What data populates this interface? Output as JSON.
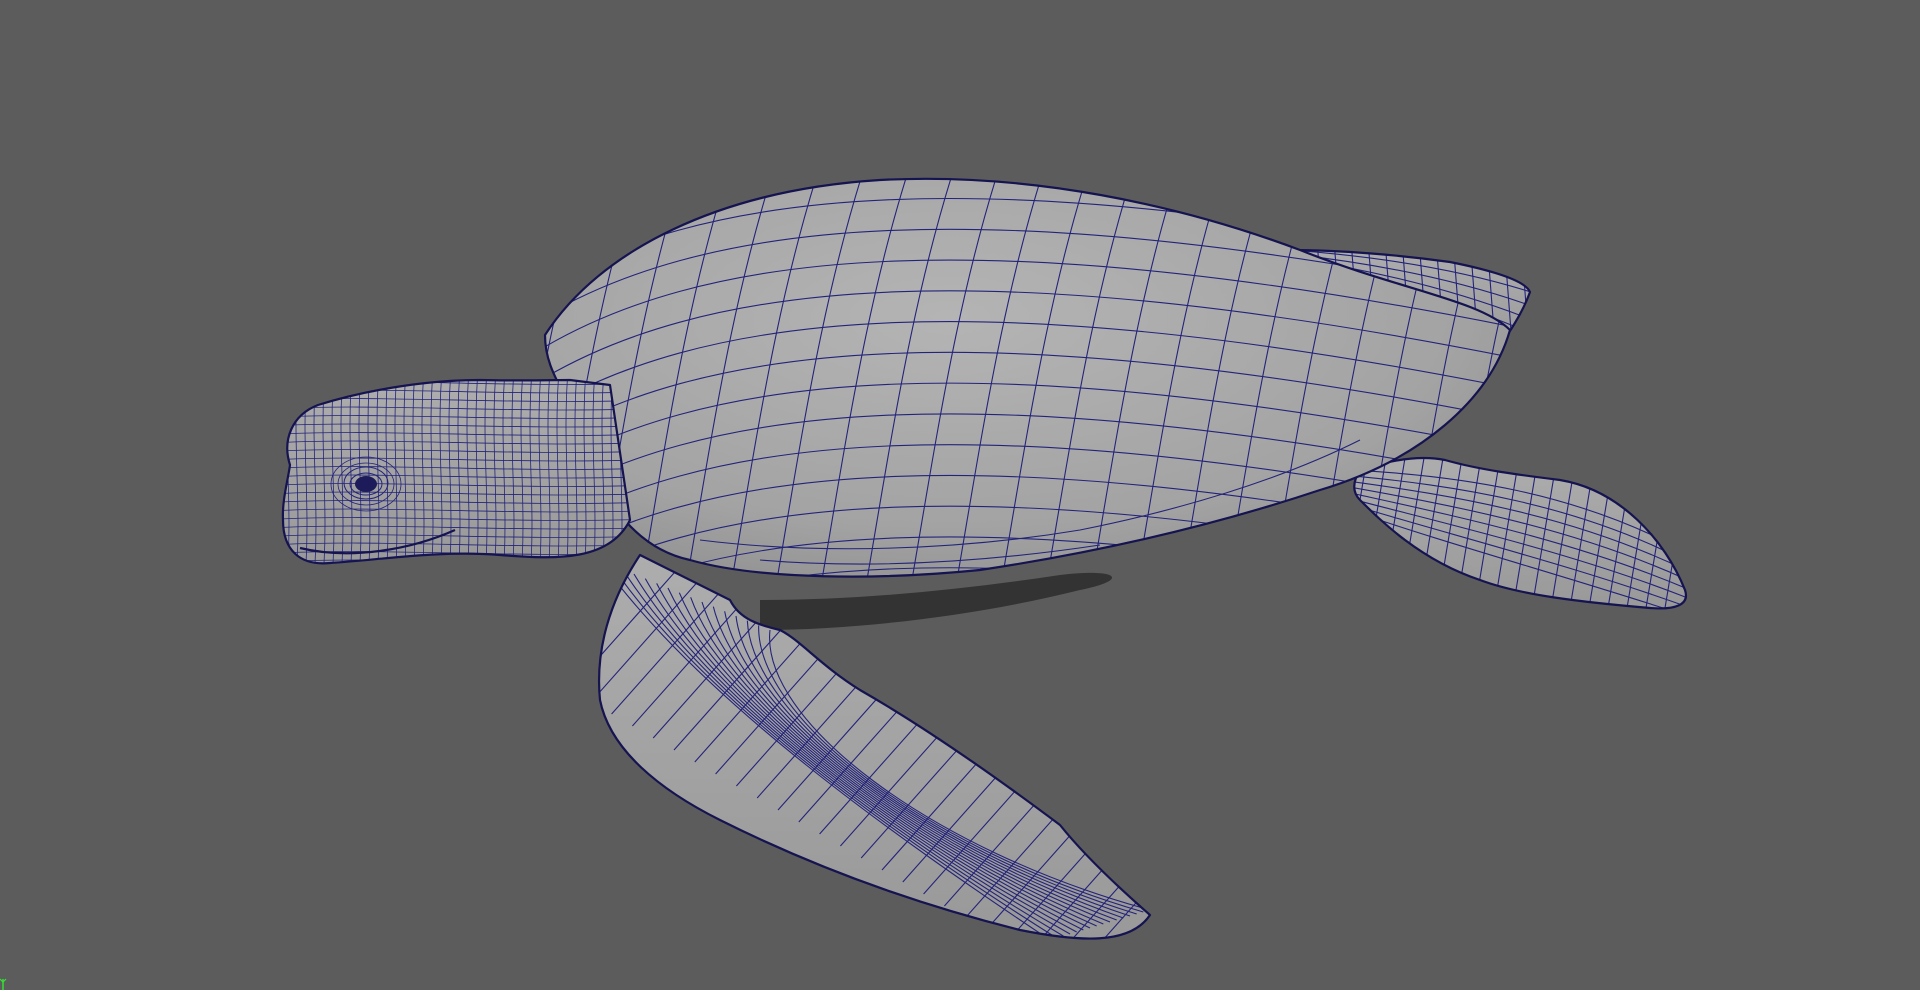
{
  "viewport": {
    "background_color": "#5c5c5c",
    "mesh_color": "#a7a7a7",
    "wire_color": "#24237a",
    "shadow_color": "#2b2b2b"
  },
  "axis_indicator": {
    "color": "#33e033",
    "label": "Y"
  }
}
